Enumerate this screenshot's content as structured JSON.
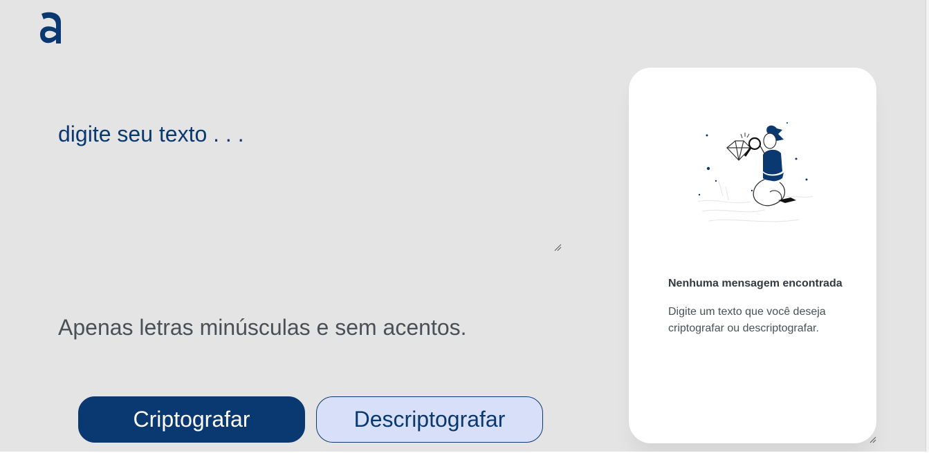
{
  "brand": {
    "logo_icon": "alura-logo-icon",
    "color": "#0a3871"
  },
  "input": {
    "placeholder": "digite seu texto . . .",
    "value": ""
  },
  "hint": {
    "text": "Apenas letras minúsculas e sem acentos."
  },
  "buttons": {
    "encrypt_label": "Criptografar",
    "decrypt_label": "Descriptografar"
  },
  "output": {
    "illustration_icon": "boy-with-magnifier-illustration",
    "title": "Nenhuma mensagem encontrada",
    "description": "Digite um texto que você deseja criptografar ou descriptografar."
  },
  "colors": {
    "background": "#e4e4e4",
    "primary": "#0a3871",
    "secondary_bg": "#d8dff8",
    "panel": "#ffffff",
    "hint": "#495057"
  }
}
